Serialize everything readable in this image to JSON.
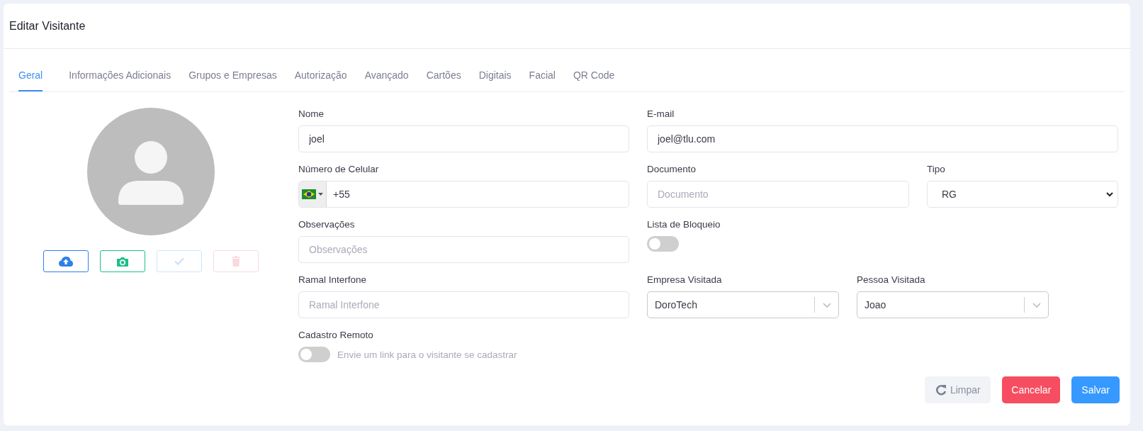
{
  "window": {
    "title": "Editar Visitante"
  },
  "tabs": [
    {
      "label": "Geral",
      "selected": true
    },
    {
      "label": "Informações Adicionais",
      "selected": false
    },
    {
      "label": "Grupos e Empresas",
      "selected": false
    },
    {
      "label": "Autorização",
      "selected": false
    },
    {
      "label": "Avançado",
      "selected": false
    },
    {
      "label": "Cartões",
      "selected": false
    },
    {
      "label": "Digitais",
      "selected": false
    },
    {
      "label": "Facial",
      "selected": false
    },
    {
      "label": "QR Code",
      "selected": false
    }
  ],
  "photo_actions": [
    {
      "kind": "upload",
      "disabled": false
    },
    {
      "kind": "camera",
      "disabled": false
    },
    {
      "kind": "confirm",
      "disabled": true
    },
    {
      "kind": "delete",
      "disabled": true
    }
  ],
  "form": {
    "nome": {
      "label": "Nome",
      "value": "joel"
    },
    "email": {
      "label": "E-mail",
      "value": "joel@tlu.com"
    },
    "celular": {
      "label": "Número de Celular",
      "value": "+55"
    },
    "documento": {
      "label": "Documento",
      "placeholder": "Documento"
    },
    "tipo": {
      "label": "Tipo",
      "value": "RG"
    },
    "observacoes": {
      "label": "Observações",
      "placeholder": "Observações"
    },
    "lista_bloqueio": {
      "label": "Lista de Bloqueio",
      "on": false
    },
    "ramal": {
      "label": "Ramal Interfone",
      "placeholder": "Ramal Interfone"
    },
    "empresa": {
      "label": "Empresa Visitada",
      "value": "DoroTech"
    },
    "pessoa": {
      "label": "Pessoa Visitada",
      "value": "Joao"
    },
    "cadastro_remoto": {
      "label": "Cadastro Remoto",
      "on": false,
      "hint": "Envie um link para o visitante se cadastrar"
    }
  },
  "buttons": [
    {
      "kind": "reset",
      "label": "Limpar"
    },
    {
      "kind": "cancel",
      "label": "Cancelar"
    },
    {
      "kind": "save",
      "label": "Salvar"
    }
  ]
}
